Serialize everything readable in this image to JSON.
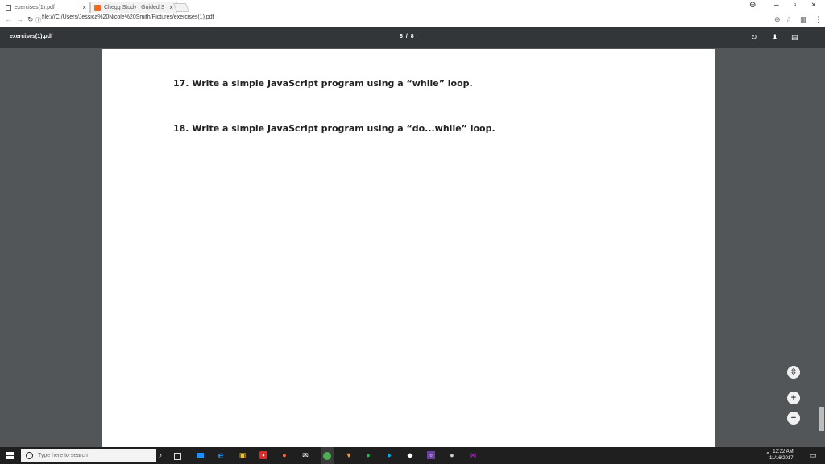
{
  "browser": {
    "tabs": [
      {
        "label": "exercises(1).pdf",
        "close": "×"
      },
      {
        "label": "Chegg Study | Guided S",
        "close": "×"
      }
    ],
    "window_controls": {
      "user": "⊖",
      "minimize": "–",
      "maximize": "▫",
      "close": "×"
    },
    "url": "file:///C:/Users/Jessica%20Nicole%20Smith/Pictures/exercises(1).pdf"
  },
  "pdf_viewer": {
    "title": "exercises(1).pdf",
    "page_indicator": "8 / 8"
  },
  "document": {
    "questions": [
      "17. Write a simple JavaScript program using a “while” loop.",
      "18. Write a simple JavaScript program using a “do...while” loop."
    ]
  },
  "zoom_controls": {
    "fit": "⇳",
    "zoom_in": "+",
    "zoom_out": "−"
  },
  "taskbar": {
    "search_placeholder": "Type here to search",
    "time": "12:22 AM",
    "date": "11/16/2017"
  },
  "colors": {
    "toolbar": "#323639",
    "viewer_background": "#525659",
    "taskbar": "#1f1f1f"
  }
}
